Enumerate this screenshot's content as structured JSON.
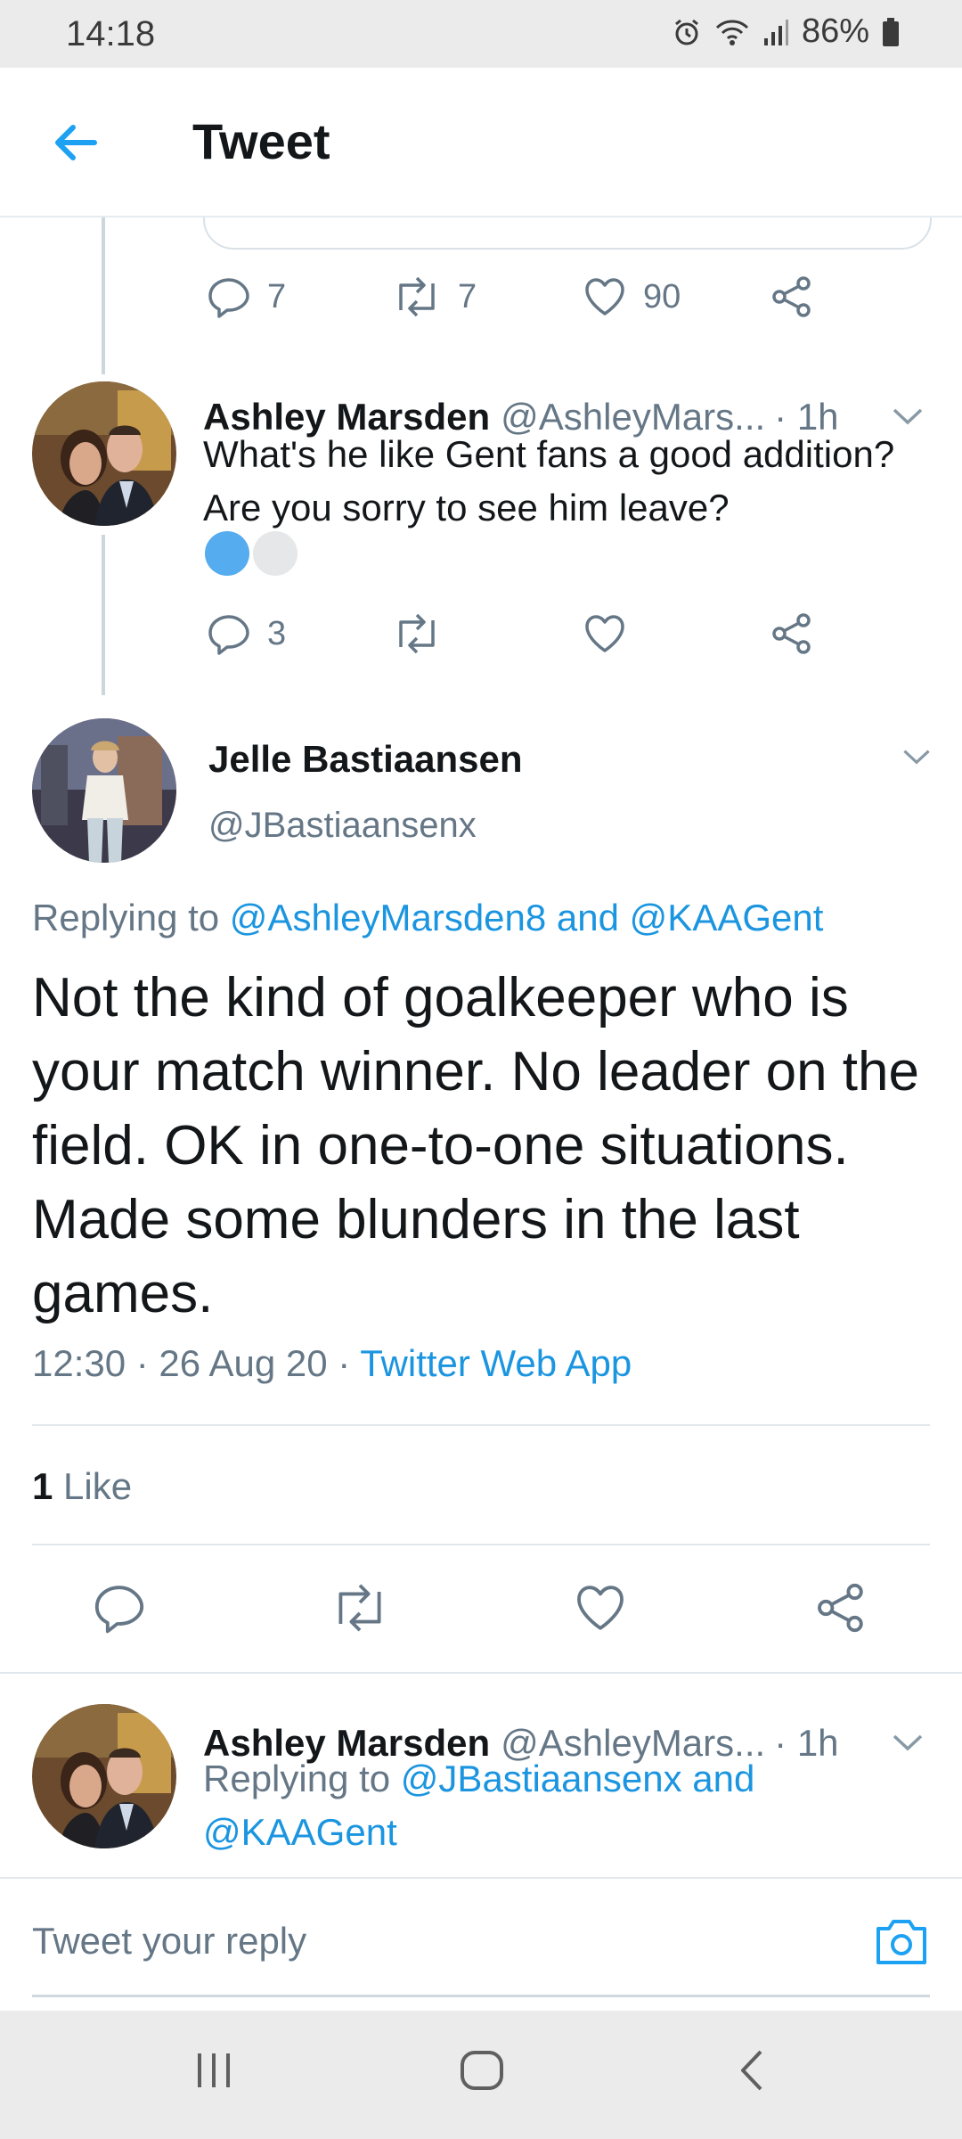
{
  "status_bar": {
    "time": "14:18",
    "battery": "86%",
    "icons": [
      "alarm-icon",
      "wifi-icon",
      "signal-icon",
      "battery-icon"
    ]
  },
  "app_bar": {
    "back_icon": "arrow-left-icon",
    "title": "Tweet"
  },
  "prev_tweet_actions": {
    "replies": "7",
    "retweets": "7",
    "likes": "90"
  },
  "reply_1": {
    "name": "Ashley Marsden",
    "handle": "@AshleyMars...",
    "time": "· 1h",
    "text": "What's he like Gent fans a good addition? Are you sorry to see him leave?",
    "emoji": [
      "blue-circle",
      "white-circle"
    ],
    "replies": "3",
    "retweets": "",
    "likes": ""
  },
  "main_tweet": {
    "name": "Jelle Bastiaansen",
    "handle": "@JBastiaansenx",
    "replying_prefix": "Replying to",
    "replying_to": "@AshleyMarsden8 and @KAAGent",
    "text": "Not the kind of goalkeeper who is your match winner. No leader on the field. OK in one-to-one situations. Made some blunders in the last games.",
    "time": "12:30 · 26 Aug 20 · ",
    "source": "Twitter Web App",
    "like_count": "1",
    "like_label": "Like"
  },
  "reply_2": {
    "name": "Ashley Marsden",
    "handle": "@AshleyMars...",
    "time": "· 1h",
    "replying_prefix": "Replying to",
    "replying_to_line1": "@JBastiaansenx and",
    "replying_to_line2": "@KAAGent"
  },
  "composer": {
    "placeholder": "Tweet your reply",
    "camera_icon": "camera-icon"
  },
  "nav_bar": {
    "icons": [
      "recent-apps-icon",
      "home-icon",
      "back-icon"
    ]
  },
  "colors": {
    "accent": "#1da1f2",
    "link": "#1b95e0",
    "muted": "#657786",
    "emoji_blue": "#55acee",
    "emoji_white": "#e6e7e8"
  }
}
